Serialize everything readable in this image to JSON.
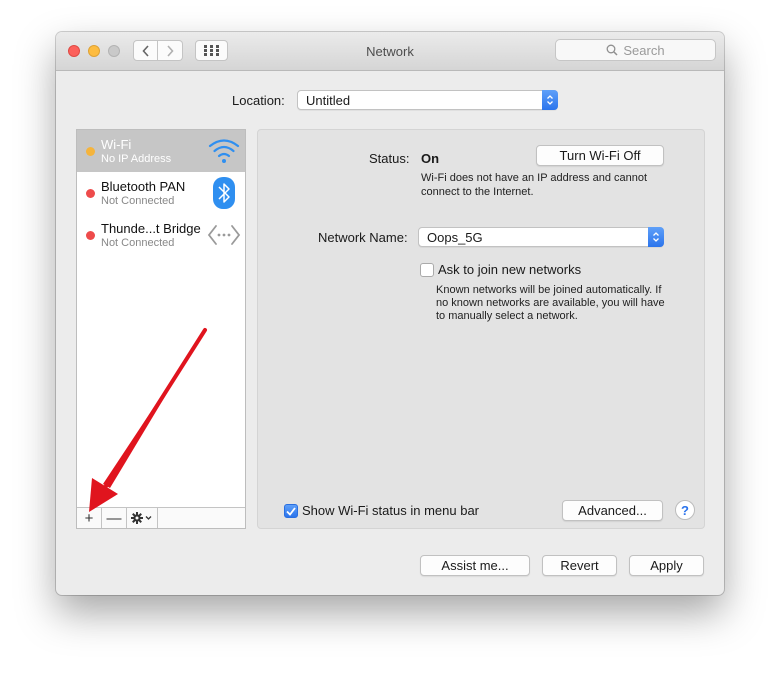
{
  "window": {
    "title": "Network"
  },
  "search": {
    "placeholder": "Search"
  },
  "location": {
    "label": "Location:",
    "value": "Untitled"
  },
  "services": [
    {
      "name": "Wi-Fi",
      "status": "No IP Address",
      "dot_color": "#f5b43c",
      "icon": "wifi-icon",
      "selected": true
    },
    {
      "name": "Bluetooth PAN",
      "status": "Not Connected",
      "dot_color": "#ee4b4b",
      "icon": "bluetooth-icon",
      "selected": false
    },
    {
      "name": "Thunde...t Bridge",
      "status": "Not Connected",
      "dot_color": "#ee4b4b",
      "icon": "thunderbolt-bridge-icon",
      "selected": false
    }
  ],
  "sidebar_tools": {
    "add": "+",
    "remove": "—",
    "action_icon": "gear-icon"
  },
  "detail": {
    "status_label": "Status:",
    "status_value": "On",
    "turn_off_button": "Turn Wi-Fi Off",
    "status_note_line1": "Wi-Fi does not have an IP address and cannot",
    "status_note_line2": "connect to the Internet.",
    "network_name_label": "Network Name:",
    "network_name_value": "Oops_5G",
    "ask_join_label": "Ask to join new networks",
    "ask_join_checked": false,
    "ask_join_note_line1": "Known networks will be joined automatically. If",
    "ask_join_note_line2": "no known networks are available, you will have",
    "ask_join_note_line3": "to manually select a network.",
    "show_status_label": "Show Wi-Fi status in menu bar",
    "show_status_checked": true,
    "advanced_button": "Advanced...",
    "help_button": "?"
  },
  "footer": {
    "assist_button": "Assist me...",
    "revert_button": "Revert",
    "apply_button": "Apply"
  },
  "colors": {
    "accent": "#2b74ec",
    "annotation_arrow": "#e0141e"
  }
}
